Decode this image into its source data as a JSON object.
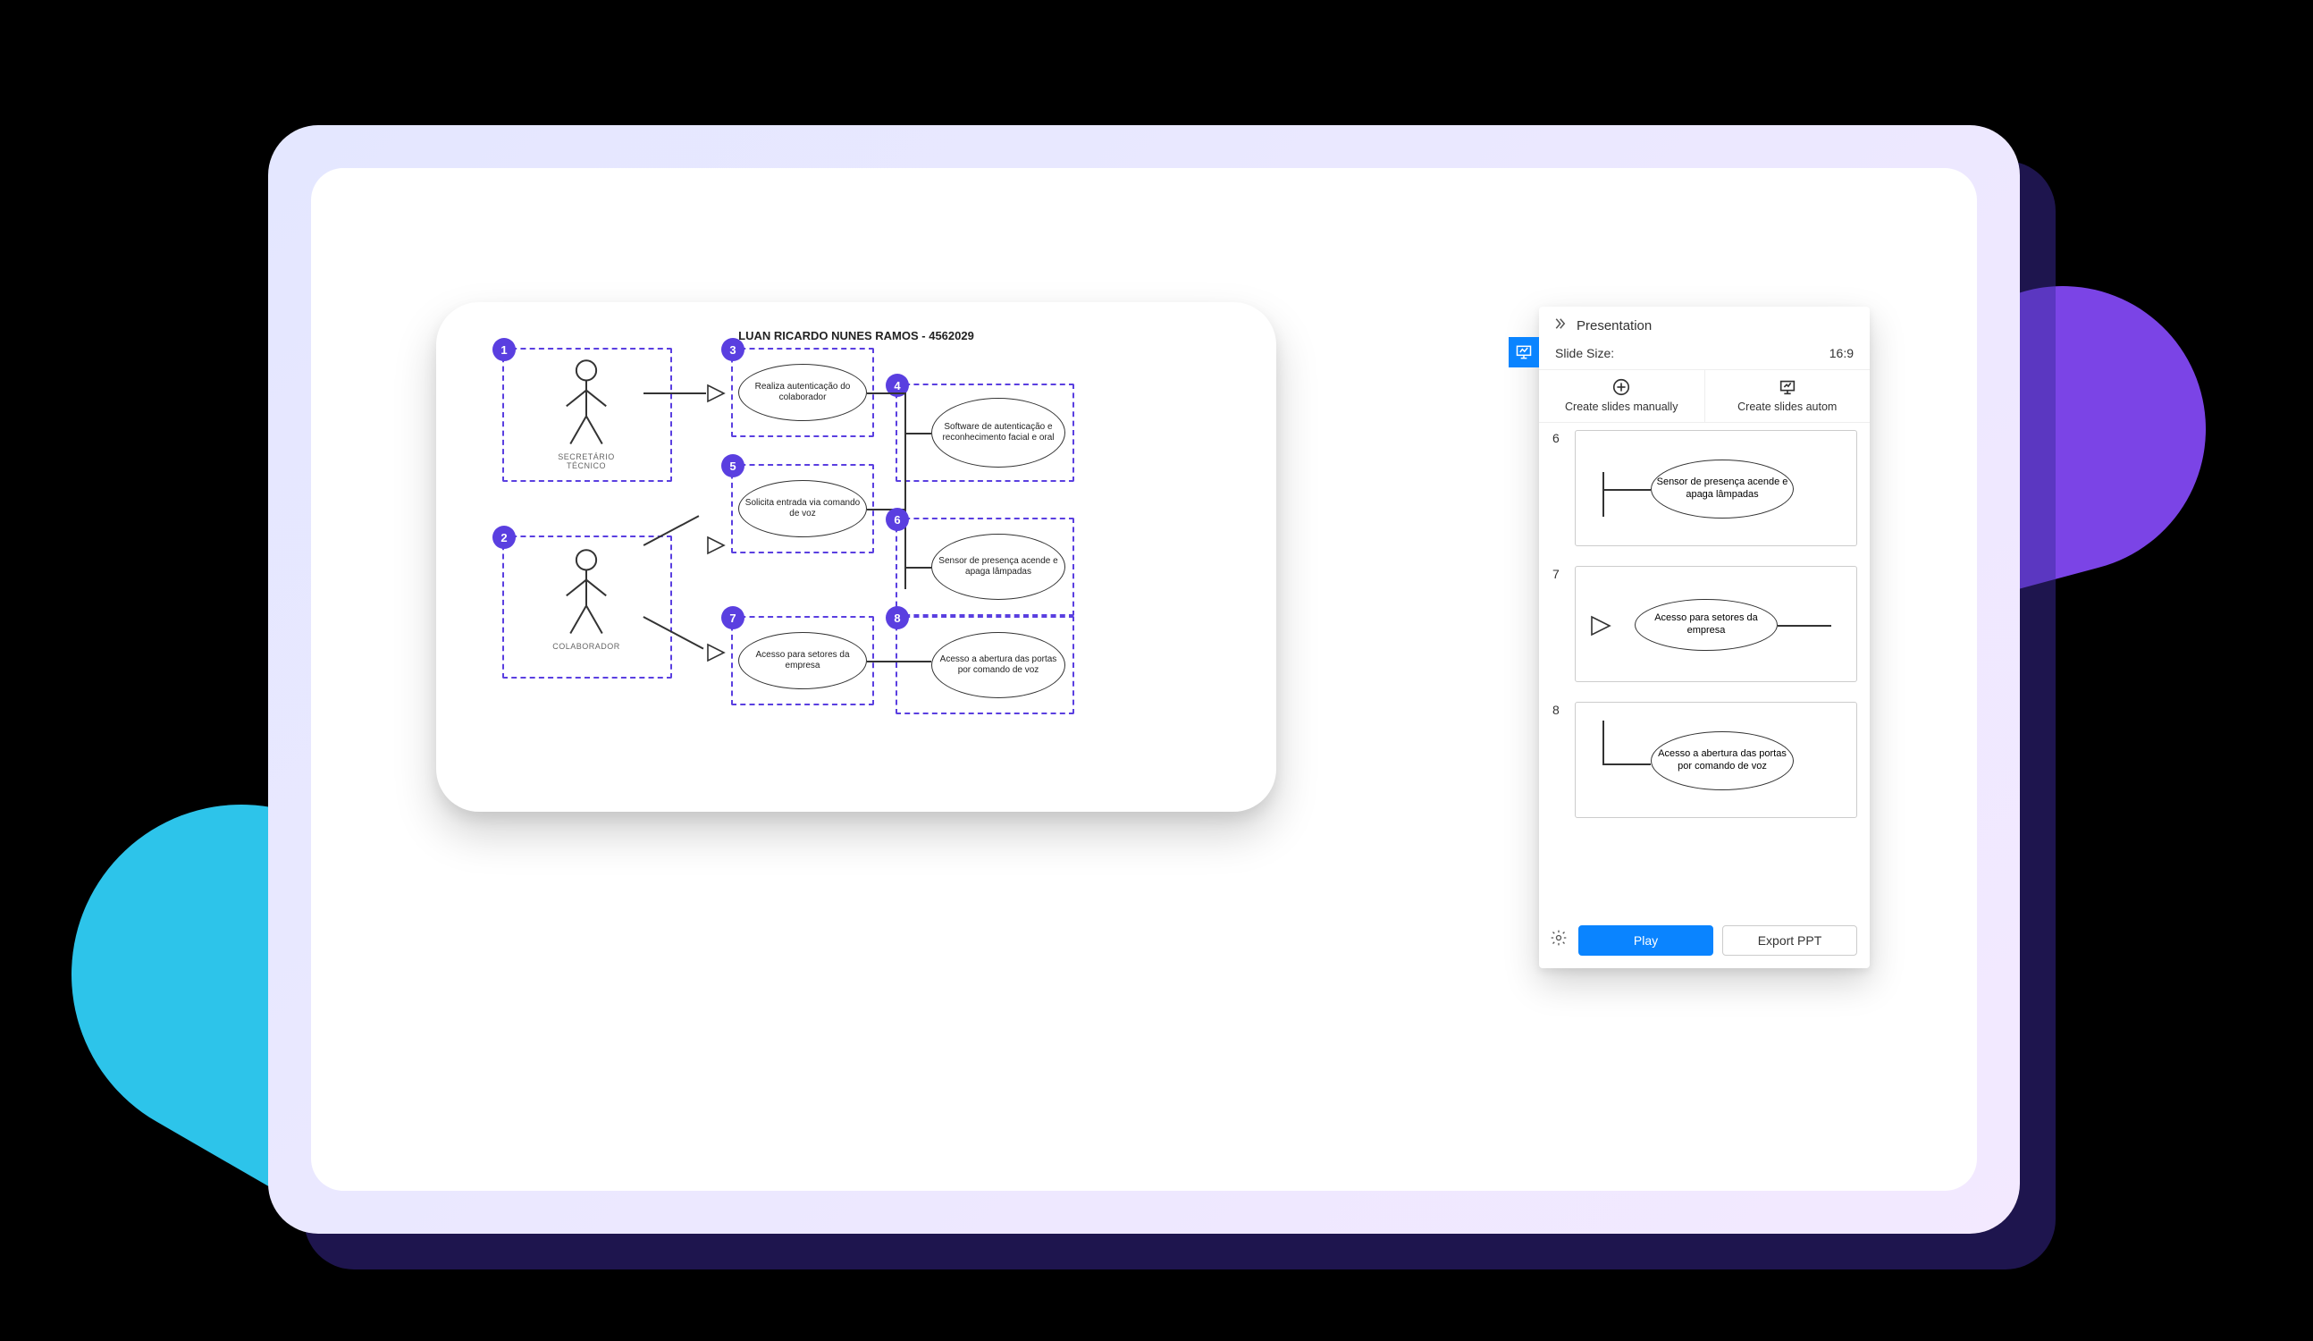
{
  "diagram": {
    "title": "LUAN RICARDO NUNES RAMOS - 4562029",
    "actors": {
      "a1": {
        "label": "SECRETÁRIO TÉCNICO"
      },
      "a2": {
        "label": "COLABORADOR"
      }
    },
    "nodes": {
      "n3": "Realiza autenticação do colaborador",
      "n4": "Software de autenticação e reconhecimento facial e oral",
      "n5": "Solicita entrada via comando de voz",
      "n6": "Sensor de presença acende e apaga lâmpadas",
      "n7": "Acesso para setores da empresa",
      "n8": "Acesso a abertura das portas por comando de voz"
    },
    "badges": {
      "b1": "1",
      "b2": "2",
      "b3": "3",
      "b4": "4",
      "b5": "5",
      "b6": "6",
      "b7": "7",
      "b8": "8"
    }
  },
  "panel": {
    "title": "Presentation",
    "slide_size_label": "Slide Size:",
    "slide_size_value": "16:9",
    "action_manual": "Create slides manually",
    "action_auto": "Create slides autom",
    "thumbs": [
      {
        "num": "6",
        "text": "Sensor de presença acende e apaga lâmpadas"
      },
      {
        "num": "7",
        "text": "Acesso para setores da empresa"
      },
      {
        "num": "8",
        "text": "Acesso a abertura das portas por comando de voz"
      }
    ],
    "play": "Play",
    "export": "Export PPT"
  }
}
